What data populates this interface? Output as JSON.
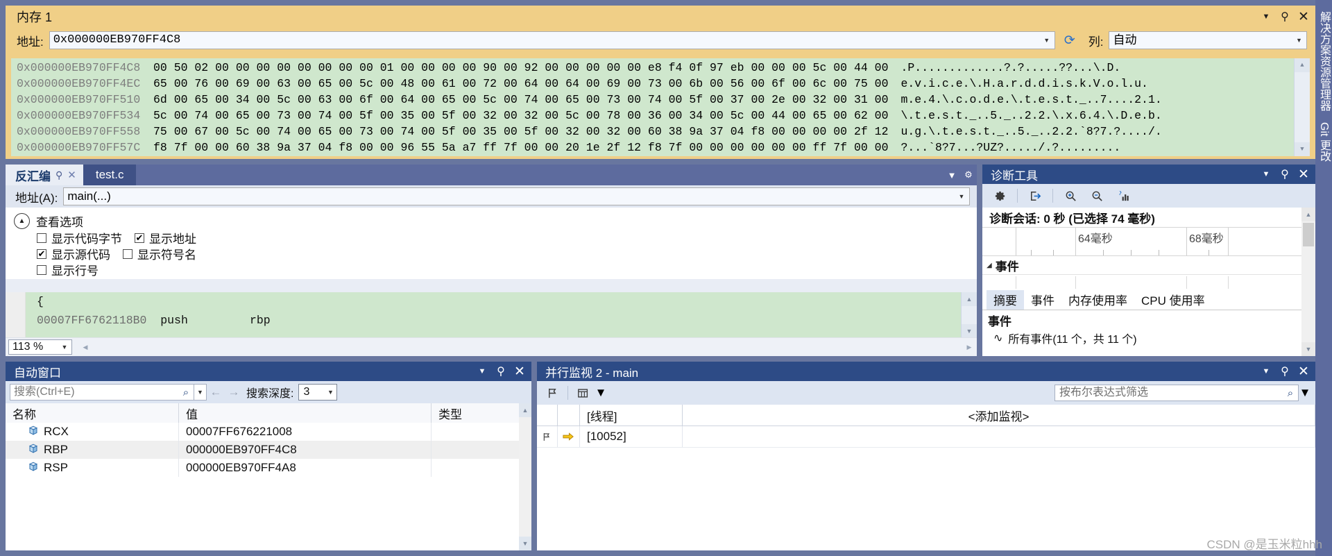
{
  "memory": {
    "title": "内存 1",
    "address_label": "地址:",
    "address_value": "0x000000EB970FF4C8",
    "refresh_icon": "refresh-icon",
    "columns_label": "列:",
    "columns_value": "自动",
    "rows": [
      {
        "addr": "0x000000EB970FF4C8",
        "hex": "00 50 02 00 00 00 00 00 00 00 00 01 00 00 00 00 90 00 92 00 00 00 00 00 e8 f4 0f 97 eb 00 00 00 5c 00 44 00",
        "ascii": ".P.............?.?.....??...\\.D."
      },
      {
        "addr": "0x000000EB970FF4EC",
        "hex": "65 00 76 00 69 00 63 00 65 00 5c 00 48 00 61 00 72 00 64 00 64 00 69 00 73 00 6b 00 56 00 6f 00 6c 00 75 00",
        "ascii": "e.v.i.c.e.\\.H.a.r.d.d.i.s.k.V.o.l.u."
      },
      {
        "addr": "0x000000EB970FF510",
        "hex": "6d 00 65 00 34 00 5c 00 63 00 6f 00 64 00 65 00 5c 00 74 00 65 00 73 00 74 00 5f 00 37 00 2e 00 32 00 31 00",
        "ascii": "m.e.4.\\.c.o.d.e.\\.t.e.s.t._..7....2.1."
      },
      {
        "addr": "0x000000EB970FF534",
        "hex": "5c 00 74 00 65 00 73 00 74 00 5f 00 35 00 5f 00 32 00 32 00 5c 00 78 00 36 00 34 00 5c 00 44 00 65 00 62 00",
        "ascii": "\\.t.e.s.t._..5._..2.2.\\.x.6.4.\\.D.e.b."
      },
      {
        "addr": "0x000000EB970FF558",
        "hex": "75 00 67 00 5c 00 74 00 65 00 73 00 74 00 5f 00 35 00 5f 00 32 00 32 00 60 38 9a 37 04 f8 00 00 00 00 2f 12",
        "ascii": "u.g.\\.t.e.s.t._..5._..2.2.`8?7.?..../."
      },
      {
        "addr": "0x000000EB970FF57C",
        "hex": "f8 7f 00 00 60 38 9a 37 04 f8 00 00 96 55 5a a7 ff 7f 00 00 20 1e 2f 12 f8 7f 00 00 00 00 00 00 ff 7f 00 00",
        "ascii": "?...`8?7...?UZ?...../.?........."
      }
    ]
  },
  "disassembly": {
    "tab_active": "反汇编",
    "tab_inactive": "test.c",
    "address_label": "地址(A):",
    "address_value": "main(...)",
    "view_options_label": "查看选项",
    "options": [
      {
        "label": "显示代码字节",
        "checked": false
      },
      {
        "label": "显示地址",
        "checked": true
      },
      {
        "label": "显示源代码",
        "checked": true
      },
      {
        "label": "显示符号名",
        "checked": false
      },
      {
        "label": "显示行号",
        "checked": false
      }
    ],
    "code_lines": [
      {
        "addr": "",
        "text": "{"
      },
      {
        "addr": "00007FF6762118B0",
        "text": "push         rbp"
      }
    ],
    "zoom_value": "113 %"
  },
  "diagnostics": {
    "title": "诊断工具",
    "toolbar_icons": [
      "settings-gear-icon",
      "export-icon",
      "zoom-in-icon",
      "zoom-out-icon",
      "chart-help-icon"
    ],
    "session_text": "诊断会话: 0 秒 (已选择 74 毫秒)",
    "ruler_labels": [
      "64毫秒",
      "68毫秒"
    ],
    "events_header": "事件",
    "tabs": [
      {
        "label": "摘要",
        "active": true
      },
      {
        "label": "事件",
        "active": false
      },
      {
        "label": "内存使用率",
        "active": false
      },
      {
        "label": "CPU 使用率",
        "active": false
      }
    ],
    "section_title": "事件",
    "list_item": "所有事件(11 个，共 11 个)"
  },
  "autos": {
    "title": "自动窗口",
    "search_placeholder": "搜索(Ctrl+E)",
    "search_icon": "search-icon",
    "nav_back_icon": "arrow-left-icon",
    "nav_forward_icon": "arrow-right-icon",
    "depth_label": "搜索深度:",
    "depth_value": "3",
    "columns": [
      "名称",
      "值",
      "类型"
    ],
    "rows": [
      {
        "name": "RCX",
        "value": "00007FF676221008",
        "type": ""
      },
      {
        "name": "RBP",
        "value": "000000EB970FF4C8",
        "type": ""
      },
      {
        "name": "RSP",
        "value": "000000EB970FF4A8",
        "type": ""
      }
    ]
  },
  "parallel_watch": {
    "title": "并行监视 2 - main",
    "flag_icon": "flag-icon",
    "columns_icon": "columns-icon",
    "filter_placeholder": "按布尔表达式筛选",
    "filter_search_icon": "search-icon",
    "columns": [
      "[线程]",
      "<添加监视>"
    ],
    "rows": [
      {
        "flag": "flag-icon",
        "arrow": "current-thread-arrow-icon",
        "thread": "[10052]",
        "watch": ""
      }
    ]
  },
  "dock": {
    "items": [
      "解决方案资源管理器",
      "Git 更改"
    ]
  },
  "watermark": "CSDN @是玉米粒hhh",
  "colors": {
    "memory_header": "#f0cf87",
    "panel_header": "#2d4b86",
    "hex_background": "#cfe7cd",
    "app_background": "#68769f"
  }
}
